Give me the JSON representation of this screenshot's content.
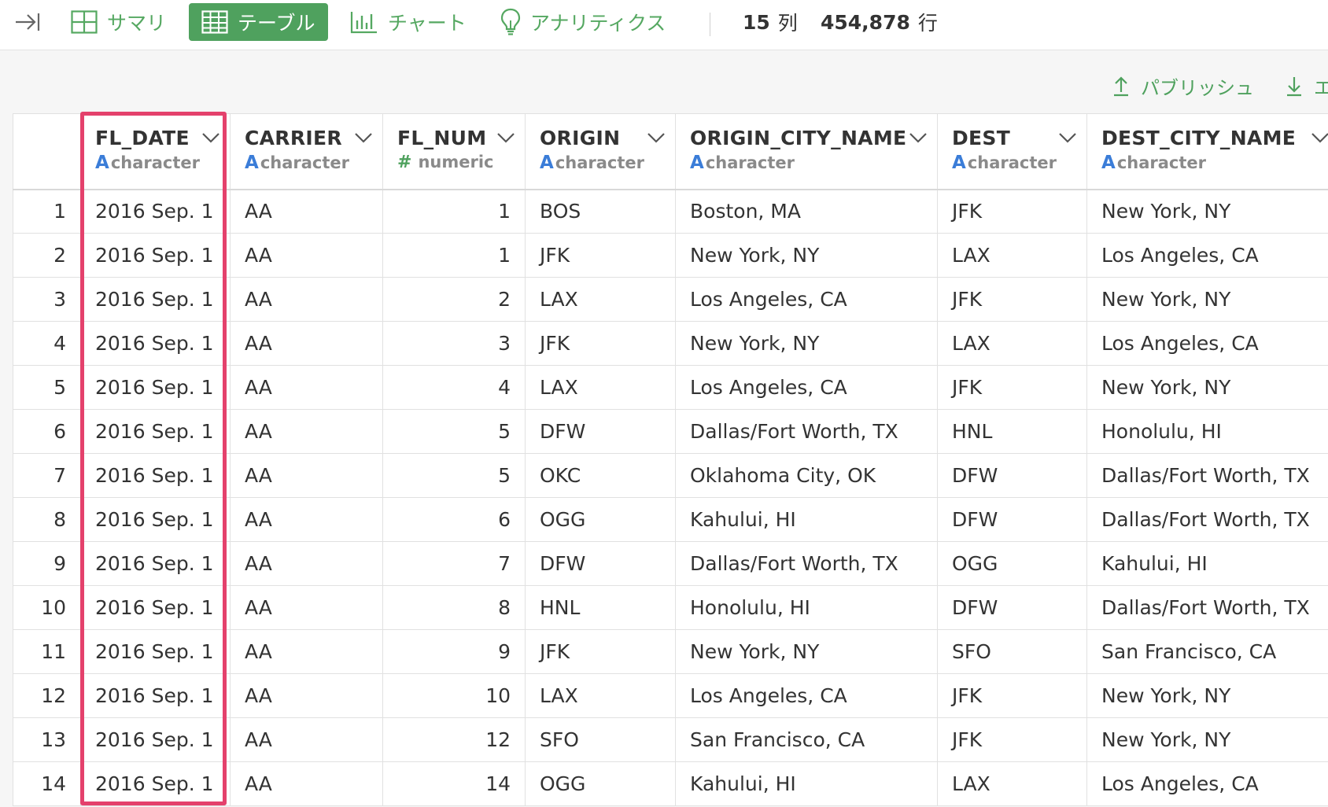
{
  "toolbar": {
    "tabs": [
      {
        "label": "サマリ",
        "icon": "grid-icon",
        "active": false
      },
      {
        "label": "テーブル",
        "icon": "table-icon",
        "active": true
      },
      {
        "label": "チャート",
        "icon": "bar-chart-icon",
        "active": false
      },
      {
        "label": "アナリティクス",
        "icon": "lightbulb-icon",
        "active": false
      }
    ],
    "column_count": "15",
    "column_unit": "列",
    "row_count": "454,878",
    "row_unit": "行"
  },
  "actions": {
    "publish_label": "パブリッシュ",
    "export_label": "エ"
  },
  "table": {
    "columns": [
      {
        "name": "FL_DATE",
        "type": "character",
        "type_symbol": "A"
      },
      {
        "name": "CARRIER",
        "type": "character",
        "type_symbol": "A"
      },
      {
        "name": "FL_NUM",
        "type": "numeric",
        "type_symbol": "#"
      },
      {
        "name": "ORIGIN",
        "type": "character",
        "type_symbol": "A"
      },
      {
        "name": "ORIGIN_CITY_NAME",
        "type": "character",
        "type_symbol": "A"
      },
      {
        "name": "DEST",
        "type": "character",
        "type_symbol": "A"
      },
      {
        "name": "DEST_CITY_NAME",
        "type": "character",
        "type_symbol": "A"
      }
    ],
    "rows": [
      [
        "1",
        "2016 Sep. 1",
        "AA",
        "1",
        "BOS",
        "Boston, MA",
        "JFK",
        "New York, NY"
      ],
      [
        "2",
        "2016 Sep. 1",
        "AA",
        "1",
        "JFK",
        "New York, NY",
        "LAX",
        "Los Angeles, CA"
      ],
      [
        "3",
        "2016 Sep. 1",
        "AA",
        "2",
        "LAX",
        "Los Angeles, CA",
        "JFK",
        "New York, NY"
      ],
      [
        "4",
        "2016 Sep. 1",
        "AA",
        "3",
        "JFK",
        "New York, NY",
        "LAX",
        "Los Angeles, CA"
      ],
      [
        "5",
        "2016 Sep. 1",
        "AA",
        "4",
        "LAX",
        "Los Angeles, CA",
        "JFK",
        "New York, NY"
      ],
      [
        "6",
        "2016 Sep. 1",
        "AA",
        "5",
        "DFW",
        "Dallas/Fort Worth, TX",
        "HNL",
        "Honolulu, HI"
      ],
      [
        "7",
        "2016 Sep. 1",
        "AA",
        "5",
        "OKC",
        "Oklahoma City, OK",
        "DFW",
        "Dallas/Fort Worth, TX"
      ],
      [
        "8",
        "2016 Sep. 1",
        "AA",
        "6",
        "OGG",
        "Kahului, HI",
        "DFW",
        "Dallas/Fort Worth, TX"
      ],
      [
        "9",
        "2016 Sep. 1",
        "AA",
        "7",
        "DFW",
        "Dallas/Fort Worth, TX",
        "OGG",
        "Kahului, HI"
      ],
      [
        "10",
        "2016 Sep. 1",
        "AA",
        "8",
        "HNL",
        "Honolulu, HI",
        "DFW",
        "Dallas/Fort Worth, TX"
      ],
      [
        "11",
        "2016 Sep. 1",
        "AA",
        "9",
        "JFK",
        "New York, NY",
        "SFO",
        "San Francisco, CA"
      ],
      [
        "12",
        "2016 Sep. 1",
        "AA",
        "10",
        "LAX",
        "Los Angeles, CA",
        "JFK",
        "New York, NY"
      ],
      [
        "13",
        "2016 Sep. 1",
        "AA",
        "12",
        "SFO",
        "San Francisco, CA",
        "JFK",
        "New York, NY"
      ],
      [
        "14",
        "2016 Sep. 1",
        "AA",
        "14",
        "OGG",
        "Kahului, HI",
        "LAX",
        "Los Angeles, CA"
      ]
    ]
  },
  "colors": {
    "accent": "#4fa15e",
    "character_type": "#3b7dd8",
    "highlight": "#e4416c"
  }
}
